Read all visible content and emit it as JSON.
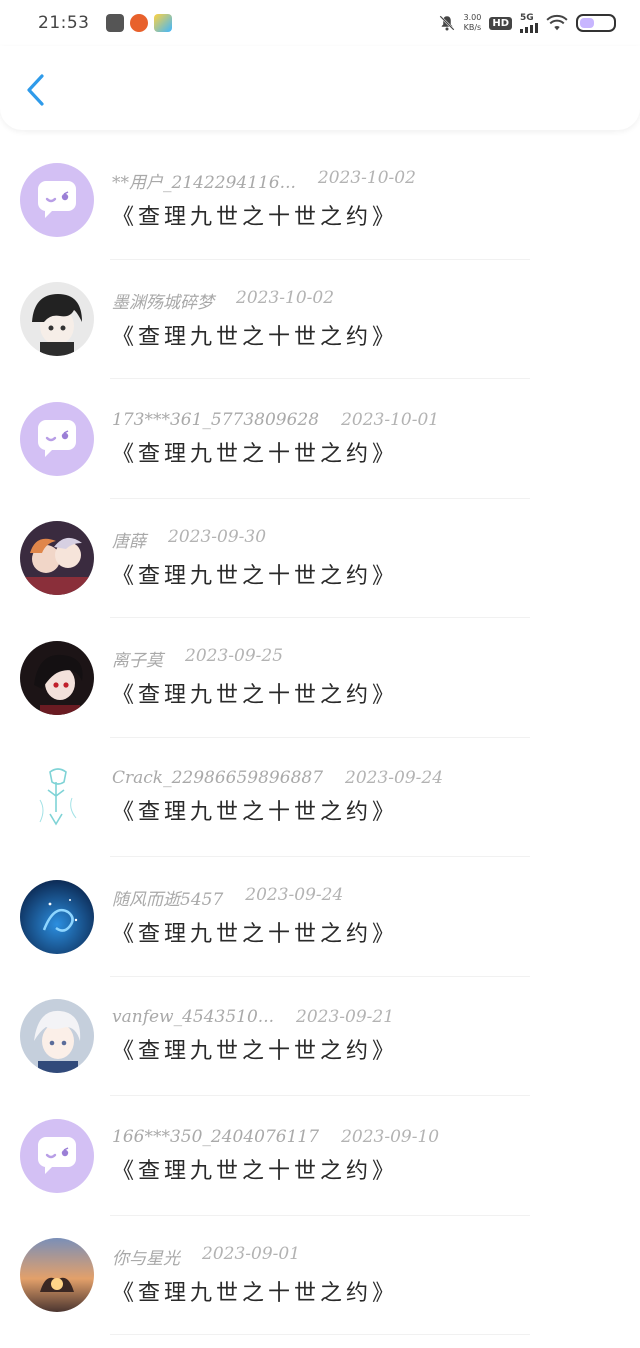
{
  "status": {
    "time": "21:53",
    "net_speed_value": "3.00",
    "net_speed_unit": "KB/s",
    "hd": "HD",
    "network": "5G",
    "battery_level": 0.45,
    "app_icons": [
      "gallery-app-icon",
      "shopping-app-icon",
      "photo-app-icon"
    ]
  },
  "header": {
    "back_icon": "chevron-left-icon"
  },
  "colors": {
    "default_avatar": "#d3c0f4",
    "accent": "#2f9bea"
  },
  "items": [
    {
      "user": "**用户_2142294116...",
      "date": "2023-10-02",
      "title": "《查理九世之十世之约》",
      "avatar": "default-chat-avatar"
    },
    {
      "user": "墨渊殇城碎梦",
      "date": "2023-10-02",
      "title": "《查理九世之十世之约》",
      "avatar": "anime-avatar-dark-hair"
    },
    {
      "user": "173***361_5773809628",
      "date": "2023-10-01",
      "title": "《查理九世之十世之约》",
      "avatar": "default-chat-avatar"
    },
    {
      "user": "唐薛",
      "date": "2023-09-30",
      "title": "《查理九世之十世之约》",
      "avatar": "anime-avatar-couple"
    },
    {
      "user": "离子莫",
      "date": "2023-09-25",
      "title": "《查理九世之十世之约》",
      "avatar": "anime-avatar-red-eyes"
    },
    {
      "user": "Crack_22986659896887",
      "date": "2023-09-24",
      "title": "《查理九世之十世之约》",
      "avatar": "sketch-avatar-cyan"
    },
    {
      "user": "随风而逝5457",
      "date": "2023-09-24",
      "title": "《查理九世之十世之约》",
      "avatar": "ocean-whale-avatar"
    },
    {
      "user": "vanfew_4543510...",
      "date": "2023-09-21",
      "title": "《查理九世之十世之约》",
      "avatar": "anime-avatar-white-hair"
    },
    {
      "user": "166***350_2404076117",
      "date": "2023-09-10",
      "title": "《查理九世之十世之约》",
      "avatar": "default-chat-avatar"
    },
    {
      "user": "你与星光",
      "date": "2023-09-01",
      "title": "《查理九世之十世之约》",
      "avatar": "sunset-hands-avatar"
    }
  ]
}
